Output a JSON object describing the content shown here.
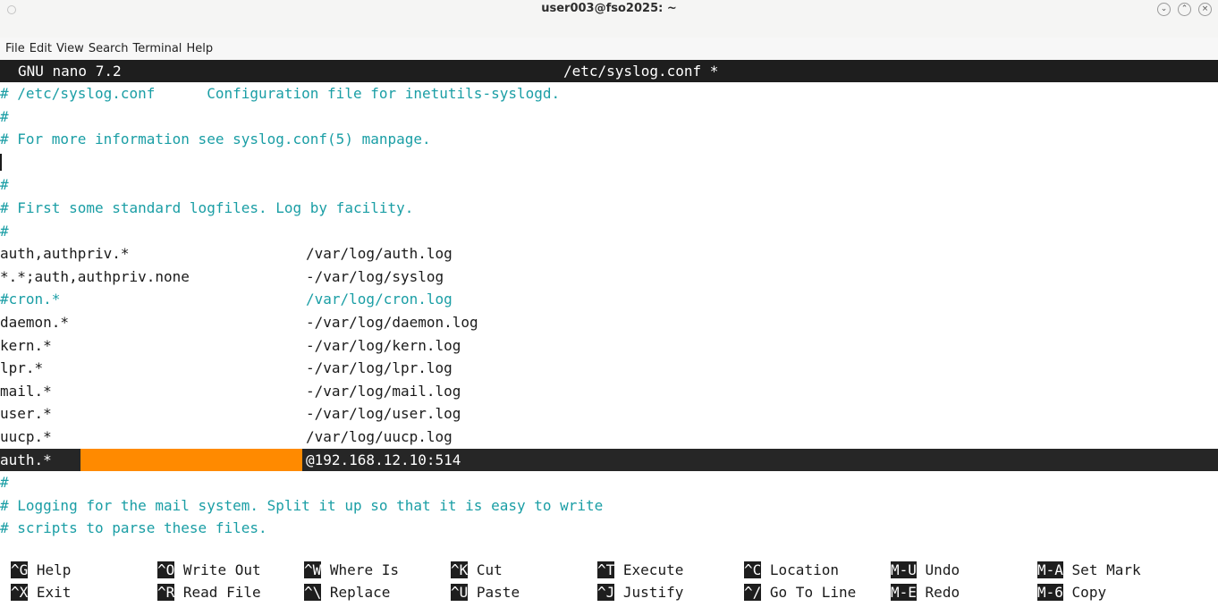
{
  "window": {
    "title": "user003@fso2025: ~"
  },
  "menu": [
    "File",
    "Edit",
    "View",
    "Search",
    "Terminal",
    "Help"
  ],
  "nano": {
    "version": "GNU nano 7.2",
    "filename": "/etc/syslog.conf *"
  },
  "lines": [
    {
      "type": "comment",
      "a": "# /etc/syslog.conf      Configuration file for inetutils-syslogd.",
      "b": ""
    },
    {
      "type": "comment",
      "a": "#",
      "b": ""
    },
    {
      "type": "comment",
      "a": "# For more information see syslog.conf(5) manpage.",
      "b": ""
    },
    {
      "type": "blank",
      "a": "",
      "b": ""
    },
    {
      "type": "comment",
      "a": "#",
      "b": ""
    },
    {
      "type": "comment",
      "a": "# First some standard logfiles. Log by facility.",
      "b": ""
    },
    {
      "type": "comment",
      "a": "#",
      "b": ""
    },
    {
      "type": "rule",
      "a": "auth,authpriv.*",
      "b": "/var/log/auth.log"
    },
    {
      "type": "rule",
      "a": "*.*;auth,authpriv.none",
      "b": "-/var/log/syslog"
    },
    {
      "type": "comment",
      "a": "#cron.*",
      "b": "/var/log/cron.log"
    },
    {
      "type": "rule",
      "a": "daemon.*",
      "b": "-/var/log/daemon.log"
    },
    {
      "type": "rule",
      "a": "kern.*",
      "b": "-/var/log/kern.log"
    },
    {
      "type": "rule",
      "a": "lpr.*",
      "b": "-/var/log/lpr.log"
    },
    {
      "type": "rule",
      "a": "mail.*",
      "b": "-/var/log/mail.log"
    },
    {
      "type": "rule",
      "a": "user.*",
      "b": "-/var/log/user.log"
    },
    {
      "type": "rule",
      "a": "uucp.*",
      "b": "/var/log/uucp.log"
    },
    {
      "type": "current",
      "a": "auth.*",
      "b": "@192.168.12.10:514"
    },
    {
      "type": "comment",
      "a": "#",
      "b": ""
    },
    {
      "type": "comment",
      "a": "# Logging for the mail system. Split it up so that it is easy to write",
      "b": ""
    },
    {
      "type": "comment",
      "a": "# scripts to parse these files.",
      "b": ""
    }
  ],
  "shortcuts": [
    [
      {
        "key": "^G",
        "label": "Help"
      },
      {
        "key": "^O",
        "label": "Write Out"
      },
      {
        "key": "^W",
        "label": "Where Is"
      },
      {
        "key": "^K",
        "label": "Cut"
      },
      {
        "key": "^T",
        "label": "Execute"
      },
      {
        "key": "^C",
        "label": "Location"
      },
      {
        "key": "M-U",
        "label": "Undo"
      },
      {
        "key": "M-A",
        "label": "Set Mark"
      }
    ],
    [
      {
        "key": "^X",
        "label": "Exit"
      },
      {
        "key": "^R",
        "label": "Read File"
      },
      {
        "key": "^\\",
        "label": "Replace"
      },
      {
        "key": "^U",
        "label": "Paste"
      },
      {
        "key": "^J",
        "label": "Justify"
      },
      {
        "key": "^/",
        "label": "Go To Line"
      },
      {
        "key": "M-E",
        "label": "Redo"
      },
      {
        "key": "M-6",
        "label": "Copy"
      }
    ]
  ],
  "colors": {
    "comment": "#1a9ea5",
    "highlight": "#ff8a00",
    "bar": "#1e1e1e"
  }
}
